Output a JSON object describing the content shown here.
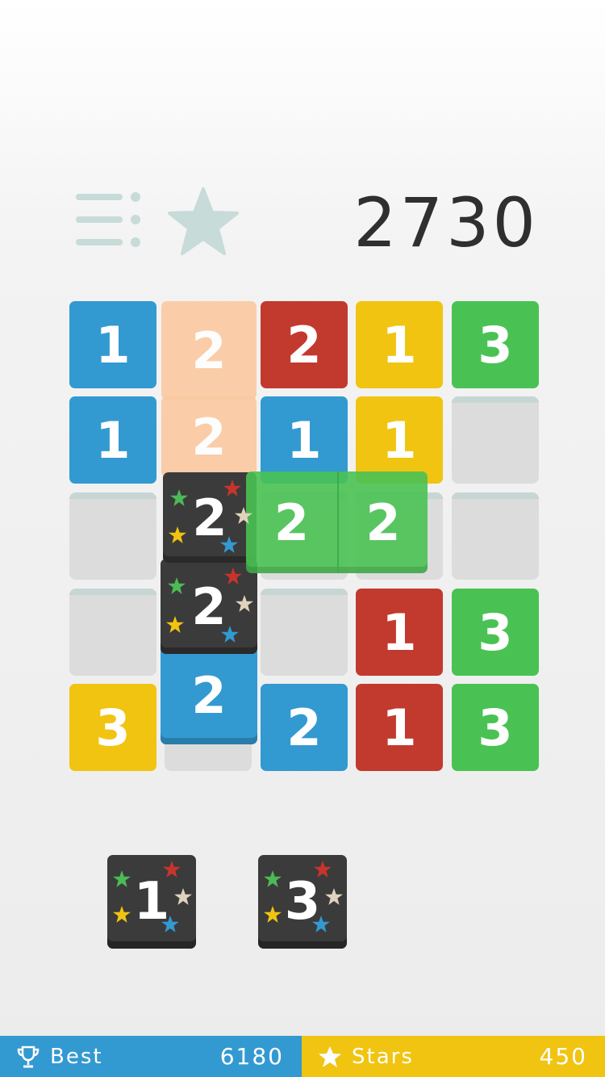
{
  "header": {
    "menu_icon": "menu-icon",
    "star_icon": "star-icon",
    "score": "2730"
  },
  "colors": {
    "blue": "#3399d1",
    "red": "#c23a2d",
    "yellow": "#f0c411",
    "green": "#49c253",
    "peach": "#fbc9a0",
    "dark": "#3b3b3b",
    "empty": "#dcdcdc"
  },
  "board": {
    "rows": [
      [
        {
          "value": "1",
          "color": "blue"
        },
        {
          "value": "2",
          "color": "peach"
        },
        {
          "value": "2",
          "color": "red"
        },
        {
          "value": "1",
          "color": "yellow"
        },
        {
          "value": "3",
          "color": "green"
        }
      ],
      [
        {
          "value": "1",
          "color": "blue"
        },
        {
          "value": "2",
          "color": "peach"
        },
        {
          "value": "1",
          "color": "blue"
        },
        {
          "value": "1",
          "color": "yellow"
        },
        {
          "value": "",
          "color": "empty"
        }
      ],
      [
        {
          "value": "",
          "color": "empty"
        },
        {
          "value": "2",
          "color": "dark"
        },
        {
          "value": "",
          "color": "empty"
        },
        {
          "value": "",
          "color": "empty"
        },
        {
          "value": "",
          "color": "empty"
        }
      ],
      [
        {
          "value": "",
          "color": "empty"
        },
        {
          "value": "2",
          "color": "dark"
        },
        {
          "value": "",
          "color": "empty"
        },
        {
          "value": "1",
          "color": "red"
        },
        {
          "value": "3",
          "color": "green"
        }
      ],
      [
        {
          "value": "3",
          "color": "yellow"
        },
        {
          "value": "2",
          "color": "blue"
        },
        {
          "value": "2",
          "color": "blue"
        },
        {
          "value": "1",
          "color": "red"
        },
        {
          "value": "3",
          "color": "green"
        }
      ]
    ],
    "dragged_piece": [
      "2",
      "2"
    ]
  },
  "tray": [
    {
      "value": "1",
      "type": "star-tile"
    },
    {
      "value": "3",
      "type": "star-tile"
    }
  ],
  "footer": {
    "best_icon": "trophy-icon",
    "best_label": "Best",
    "best_value": "6180",
    "stars_icon": "star-icon",
    "stars_label": "Stars",
    "stars_value": "450"
  }
}
